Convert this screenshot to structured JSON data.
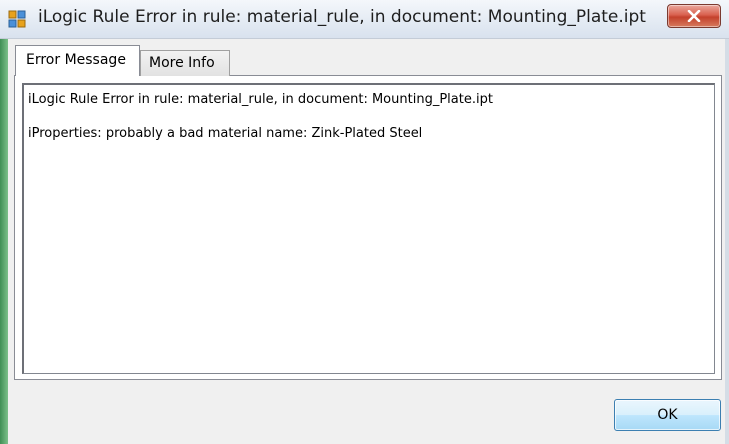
{
  "window": {
    "title": "iLogic Rule Error in rule: material_rule, in document: Mounting_Plate.ipt",
    "icon": "application-window-icon",
    "close_icon": "close-x-icon"
  },
  "tabs": [
    {
      "label": "Error Message",
      "selected": true
    },
    {
      "label": "More Info",
      "selected": false
    }
  ],
  "message": {
    "lines": [
      "iLogic Rule Error in rule: material_rule, in document: Mounting_Plate.ipt",
      "iProperties: probably a bad material name: Zink-Plated Steel"
    ]
  },
  "buttons": {
    "ok_label": "OK"
  },
  "colors": {
    "close_button": "#c4412c",
    "ok_button_border": "#3c7fb1"
  }
}
